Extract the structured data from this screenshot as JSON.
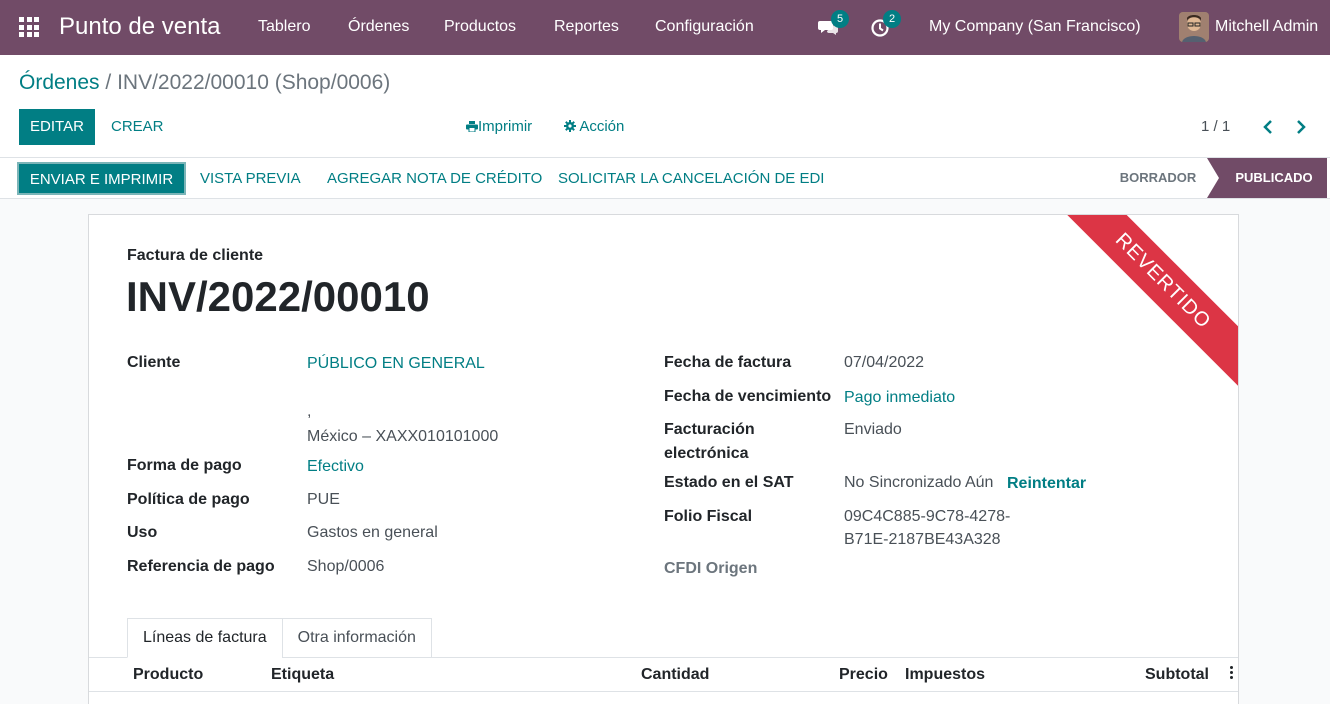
{
  "navbar": {
    "brand": "Punto de venta",
    "menus": [
      "Tablero",
      "Órdenes",
      "Productos",
      "Reportes",
      "Configuración"
    ],
    "messages_badge": "5",
    "activities_badge": "2",
    "company": "My Company (San Francisco)",
    "user": "Mitchell Admin"
  },
  "breadcrumb": {
    "parent": "Órdenes",
    "separator": "/",
    "current": "INV/2022/00010 (Shop/0006)"
  },
  "toolbar": {
    "edit": "EDITAR",
    "create": "CREAR",
    "print": "Imprimir",
    "action": "Acción",
    "pager": "1 / 1"
  },
  "statusbar": {
    "send_print": "ENVIAR E IMPRIMIR",
    "preview": "VISTA PREVIA",
    "credit_note": "AGREGAR NOTA DE CRÉDITO",
    "cancel_edi": "SOLICITAR LA CANCELACIÓN DE EDI",
    "stage_draft": "BORRADOR",
    "stage_posted": "PUBLICADO"
  },
  "invoice": {
    "ribbon": "REVERTIDO",
    "type": "Factura de cliente",
    "name": "INV/2022/00010",
    "left_fields": {
      "customer_label": "Cliente",
      "customer_value": "PÚBLICO EN GENERAL",
      "address_line1": ",",
      "address_line2": "México – XAXX010101000",
      "payment_method_label": "Forma de pago",
      "payment_method_value": "Efectivo",
      "payment_policy_label": "Política de pago",
      "payment_policy_value": "PUE",
      "usage_label": "Uso",
      "usage_value": "Gastos en general",
      "payment_ref_label": "Referencia de pago",
      "payment_ref_value": "Shop/0006"
    },
    "right_fields": {
      "invoice_date_label": "Fecha de factura",
      "invoice_date_value": "07/04/2022",
      "due_date_label": "Fecha de vencimiento",
      "due_date_value": "Pago inmediato",
      "einvoice_label_1": "Facturación",
      "einvoice_label_2": "electrónica",
      "einvoice_value": "Enviado",
      "sat_label": "Estado en el SAT",
      "sat_value": "No Sincronizado Aún",
      "sat_retry": "Reintentar",
      "folio_label": "Folio Fiscal",
      "folio_line1": "09C4C885-9C78-4278-",
      "folio_line2": "B71E-2187BE43A328",
      "cfdi_label": "CFDI Origen"
    },
    "tabs": [
      "Líneas de factura",
      "Otra información"
    ],
    "columns": [
      "Producto",
      "Etiqueta",
      "Cantidad",
      "Precio",
      "Impuestos",
      "Subtotal"
    ]
  }
}
